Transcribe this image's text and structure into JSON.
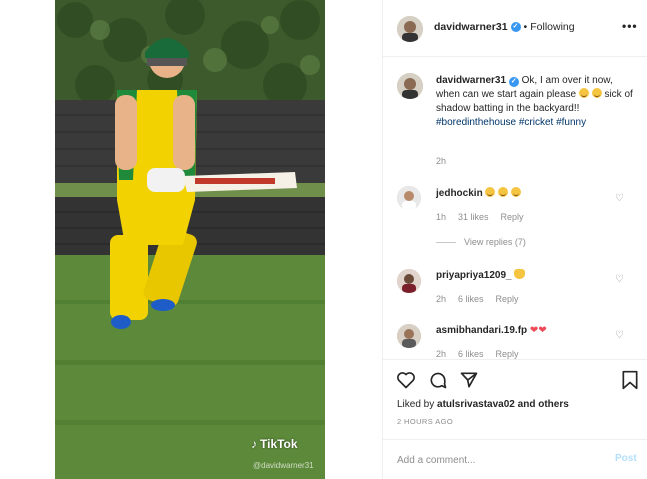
{
  "media": {
    "watermark_brand": "TikTok",
    "watermark_handle": "@davidwarner31"
  },
  "header": {
    "username": "davidwarner31",
    "separator": "•",
    "follow_status": "Following",
    "more_icon": "more-dots-icon"
  },
  "caption": {
    "username": "davidwarner31",
    "text_part1": "Ok, I am over it now, when can we start again please",
    "text_part2": "sick of shadow batting in the backyard!!",
    "hashtags": [
      "#boredinthehouse",
      "#cricket",
      "#funny"
    ],
    "time": "2h"
  },
  "comments": [
    {
      "username": "jedhockin",
      "time": "1h",
      "likes": "31 likes",
      "reply": "Reply"
    },
    {
      "username": "priyapriya1209_",
      "time": "2h",
      "likes": "6 likes",
      "reply": "Reply"
    },
    {
      "username": "asmibhandari.19.fp",
      "time": "2h",
      "likes": "6 likes",
      "reply": "Reply"
    }
  ],
  "view_replies": "View replies (7)",
  "actions": {
    "liked_by_prefix": "Liked by",
    "liked_by_user": "atulsrivastava02",
    "liked_by_suffix": "and others",
    "timestamp": "2 HOURS AGO"
  },
  "add_comment": {
    "placeholder": "Add a comment...",
    "post_label": "Post"
  },
  "colors": {
    "link": "#003569",
    "verified": "#3897f0",
    "muted": "#8e8e8e",
    "post_disabled": "#b2dffc"
  }
}
